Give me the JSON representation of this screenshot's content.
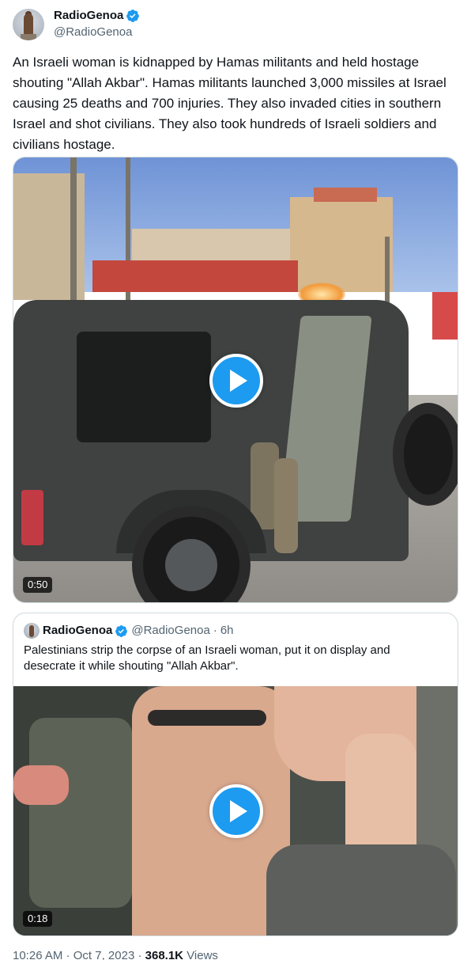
{
  "author": {
    "display_name": "RadioGenoa",
    "handle": "@RadioGenoa",
    "verified_color": "#1d9bf0"
  },
  "tweet": {
    "text": "An Israeli woman is kidnapped by Hamas militants and held hostage shouting \"Allah Akbar\". Hamas militants launched 3,000 missiles at Israel causing 25 deaths and 700 injuries. They also invaded cities in southern Israel and shot civilians. They also took hundreds of Israeli soldiers and civilians hostage.",
    "video_duration": "0:50"
  },
  "quoted_tweet": {
    "display_name": "RadioGenoa",
    "handle": "@RadioGenoa",
    "separator": "·",
    "time": "6h",
    "text": "Palestinians strip the corpse of an Israeli woman, put it on display and desecrate it while shouting \"Allah Akbar\".",
    "video_duration": "0:18"
  },
  "footer": {
    "time": "10:26 AM",
    "separator1": "·",
    "date": "Oct 7, 2023",
    "separator2": "·",
    "views_count": "368.1K",
    "views_label": "Views"
  },
  "icons": {
    "verified": "verified-badge-icon",
    "play": "play-icon"
  },
  "colors": {
    "accent": "#1d9bf0",
    "text": "#0f1419",
    "secondary": "#536471",
    "border": "#cfd9de"
  }
}
